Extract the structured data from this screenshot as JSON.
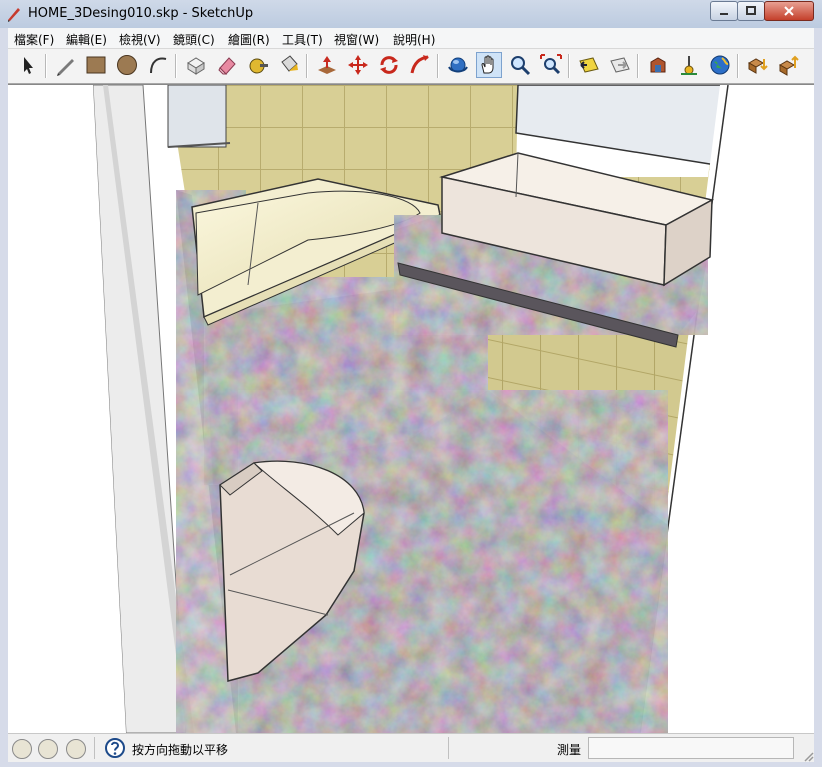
{
  "window": {
    "title": "HOME_3Desing010.skp - SketchUp",
    "controls": [
      "minimize",
      "maximize",
      "close"
    ]
  },
  "menu": {
    "items": [
      "檔案(F)",
      "編輯(E)",
      "檢視(V)",
      "鏡頭(C)",
      "繪圖(R)",
      "工具(T)",
      "視窗(W)",
      "說明(H)"
    ]
  },
  "toolbar": {
    "tools": [
      {
        "icon": "select-arrow-icon"
      },
      {
        "icon": "pencil-line-icon"
      },
      {
        "icon": "rectangle-icon"
      },
      {
        "icon": "circle-icon"
      },
      {
        "icon": "arc-icon"
      },
      {
        "icon": "make-component-icon"
      },
      {
        "icon": "eraser-icon"
      },
      {
        "icon": "tape-measure-icon"
      },
      {
        "icon": "paint-bucket-icon"
      },
      {
        "icon": "push-pull-icon"
      },
      {
        "icon": "move-icon"
      },
      {
        "icon": "rotate-icon"
      },
      {
        "icon": "follow-me-icon"
      },
      {
        "icon": "orbit-icon"
      },
      {
        "icon": "pan-hand-icon",
        "active": true
      },
      {
        "icon": "zoom-icon"
      },
      {
        "icon": "zoom-extents-icon"
      },
      {
        "icon": "previous-view-icon"
      },
      {
        "icon": "next-view-icon"
      },
      {
        "icon": "3d-warehouse-icon"
      },
      {
        "icon": "place-model-icon"
      },
      {
        "icon": "google-earth-icon"
      },
      {
        "icon": "get-models-icon"
      },
      {
        "icon": "share-model-icon"
      }
    ]
  },
  "status": {
    "hint": "按方向拖動以平移",
    "measure_label": "測量",
    "measure_value": "",
    "icons": [
      "geo-location-icon",
      "credits-icon",
      "license-icon",
      "help-icon"
    ]
  },
  "colors": {
    "marble": "#6f6870",
    "wall_tile": "#d8cf95",
    "tub_white": "#f5f1cf",
    "sink_basin": "#ede4dc",
    "toilet": "#e8dcd3",
    "window_glass": "#e7ebf0"
  }
}
